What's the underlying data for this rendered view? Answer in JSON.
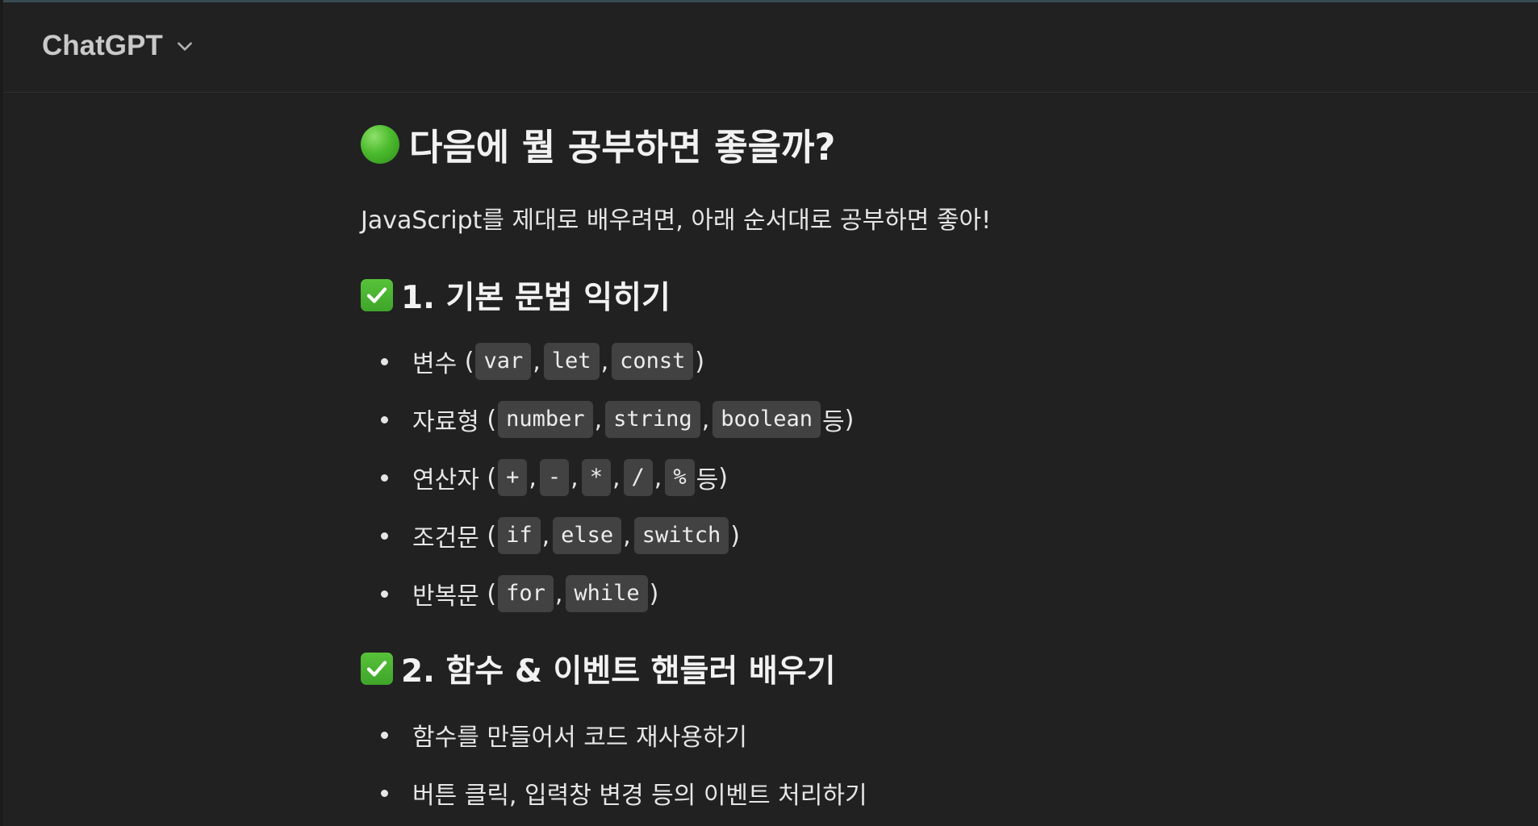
{
  "app": {
    "model_name": "ChatGPT"
  },
  "message": {
    "heading": "다음에 뭘 공부하면 좋을까?",
    "intro": "JavaScript를 제대로 배우려면, 아래 순서대로 공부하면 좋아!",
    "sections": [
      {
        "title": "1. 기본 문법 익히기",
        "items": [
          {
            "label": "변수",
            "codes": [
              "var",
              "let",
              "const"
            ],
            "suffix": ""
          },
          {
            "label": "자료형",
            "codes": [
              "number",
              "string",
              "boolean"
            ],
            "suffix": " 등"
          },
          {
            "label": "연산자",
            "codes": [
              "+",
              "-",
              "*",
              "/",
              "%"
            ],
            "suffix": " 등"
          },
          {
            "label": "조건문",
            "codes": [
              "if",
              "else",
              "switch"
            ],
            "suffix": ""
          },
          {
            "label": "반복문",
            "codes": [
              "for",
              "while"
            ],
            "suffix": ""
          }
        ]
      },
      {
        "title": "2. 함수 & 이벤트 핸들러 배우기",
        "items": [
          {
            "label": "함수를 만들어서 코드 재사용하기"
          },
          {
            "label": "버튼 클릭, 입력창 변경 등의 이벤트 처리하기"
          }
        ]
      }
    ]
  },
  "icons": {
    "heading_icon": "green-circle-icon",
    "section_icon": "check-mark-button-icon",
    "model_dropdown_icon": "chevron-down-icon"
  },
  "colors": {
    "background": "#212121",
    "inline_code_bg": "#424242",
    "check_green": "#4cb432"
  }
}
